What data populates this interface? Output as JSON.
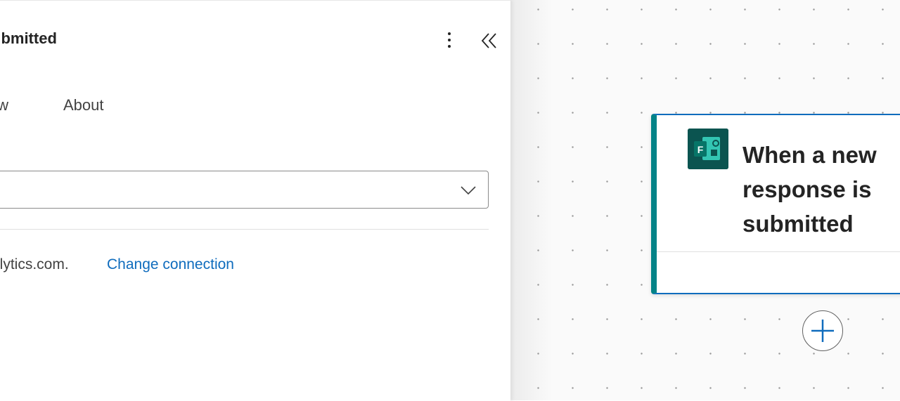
{
  "panel": {
    "title": "ubmitted",
    "more_icon": "more-vertical-icon",
    "collapse_icon": "chevrons-left-icon",
    "tabs": [
      {
        "label": "view"
      },
      {
        "label": "About"
      }
    ],
    "dropdown": {
      "value": "",
      "icon": "chevron-down-icon"
    },
    "connection": {
      "text": "alytics.com.",
      "link_label": "Change connection"
    }
  },
  "canvas": {
    "trigger_card": {
      "title": "When a new response is submitted",
      "icon": "microsoft-forms-icon",
      "accent_color": "#038387",
      "selected_border_color": "#0f6cbd"
    },
    "add_step_icon": "plus-icon"
  }
}
